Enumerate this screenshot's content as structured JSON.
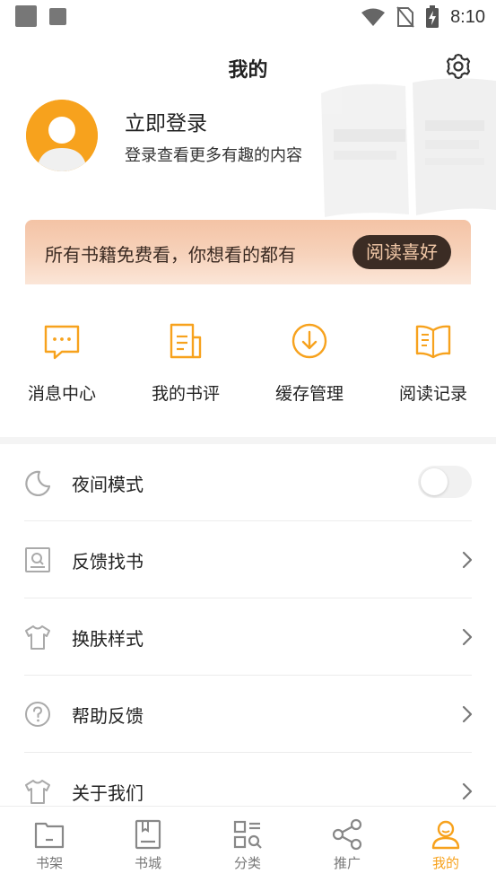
{
  "status_bar": {
    "time": "8:10"
  },
  "header": {
    "title": "我的",
    "settings_icon": "gear-icon"
  },
  "profile": {
    "login_title": "立即登录",
    "login_subtitle": "登录查看更多有趣的内容",
    "avatar_color": "#f7a21d"
  },
  "promo": {
    "text": "所有书籍免费看，你想看的都有",
    "button_label": "阅读喜好"
  },
  "quick_actions": [
    {
      "label": "消息中心",
      "icon": "message-icon"
    },
    {
      "label": "我的书评",
      "icon": "review-icon"
    },
    {
      "label": "缓存管理",
      "icon": "download-icon"
    },
    {
      "label": "阅读记录",
      "icon": "open-book-icon"
    }
  ],
  "menu": {
    "night_mode": {
      "label": "夜间模式",
      "icon": "moon-icon",
      "enabled": false
    },
    "items": [
      {
        "label": "反馈找书",
        "icon": "search-book-icon"
      },
      {
        "label": "换肤样式",
        "icon": "shirt-icon"
      },
      {
        "label": "帮助反馈",
        "icon": "help-icon"
      },
      {
        "label": "关于我们",
        "icon": "shirt-icon"
      }
    ]
  },
  "tabbar": {
    "active_index": 4,
    "tabs": [
      {
        "label": "书架",
        "icon": "bookshelf-icon"
      },
      {
        "label": "书城",
        "icon": "bookstore-icon"
      },
      {
        "label": "分类",
        "icon": "category-icon"
      },
      {
        "label": "推广",
        "icon": "share-icon"
      },
      {
        "label": "我的",
        "icon": "user-icon"
      }
    ]
  },
  "colors": {
    "accent": "#f7a21d",
    "promo_button_bg": "#3b2c24",
    "promo_button_text": "#f3c9a8",
    "tab_inactive": "#777777"
  }
}
